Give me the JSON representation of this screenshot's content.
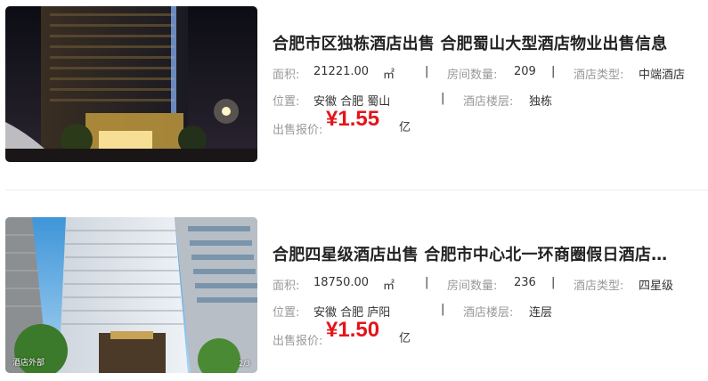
{
  "listings": [
    {
      "title": "合肥市区独栋酒店出售 合肥蜀山大型酒店物业出售信息",
      "area_label": "面积:",
      "area_value": "21221.00",
      "area_unit": "㎡",
      "separator": "|",
      "rooms_label": "房间数量:",
      "rooms_value": "209",
      "type_label": "酒店类型:",
      "type_value": "中端酒店",
      "location_label": "位置:",
      "location_value": "安徽 合肥 蜀山",
      "floors_label": "酒店楼层:",
      "floors_value": "独栋",
      "price_label": "出售报价:",
      "price_value": "¥1.55",
      "price_unit": "亿"
    },
    {
      "title": "合肥四星级酒店出售 合肥市中心北一环商圈假日酒店…",
      "area_label": "面积:",
      "area_value": "18750.00",
      "area_unit": "㎡",
      "separator": "|",
      "rooms_label": "房间数量:",
      "rooms_value": "236",
      "type_label": "酒店类型:",
      "type_value": "四星级",
      "location_label": "位置:",
      "location_value": "安徽 合肥 庐阳",
      "floors_label": "酒店楼层:",
      "floors_value": "连层",
      "price_label": "出售报价:",
      "price_value": "¥1.50",
      "price_unit": "亿",
      "photo_caption": "酒店外部",
      "photo_counter": "2/3"
    }
  ]
}
